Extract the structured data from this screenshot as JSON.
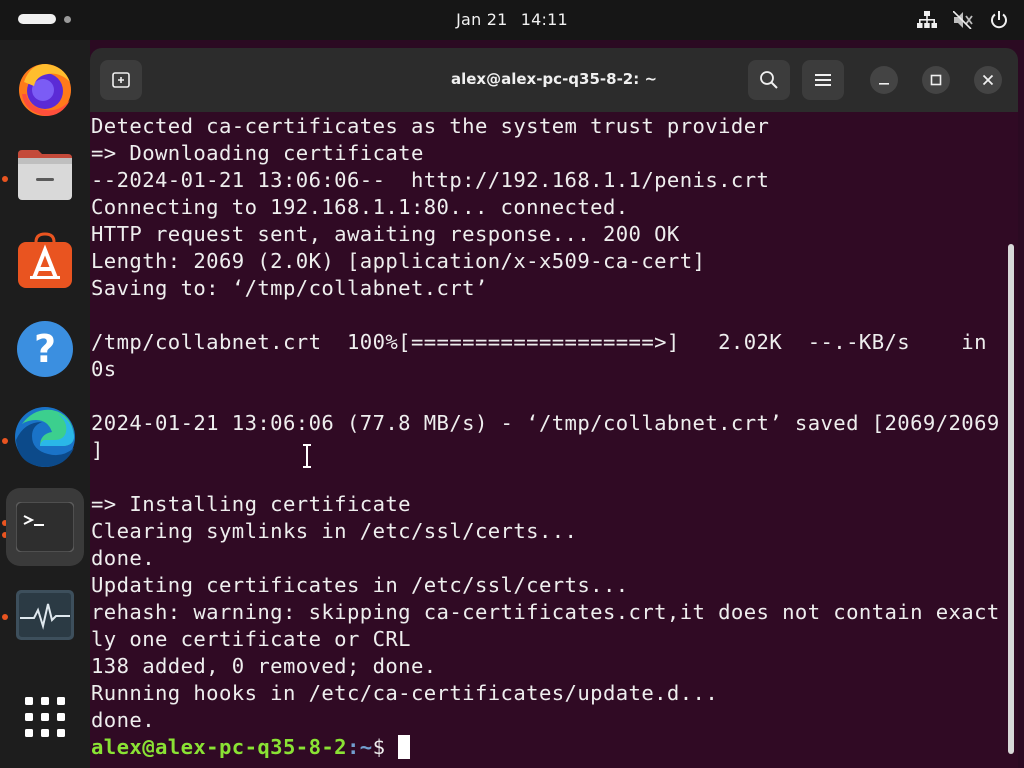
{
  "topbar": {
    "date": "Jan 21",
    "time": "14:11",
    "tray_icons": [
      "network-icon",
      "volume-muted-icon",
      "power-icon"
    ]
  },
  "dock": {
    "items": [
      {
        "name": "firefox",
        "icon": "firefox-icon",
        "running": false
      },
      {
        "name": "files",
        "icon": "files-icon",
        "running": true
      },
      {
        "name": "app-center",
        "icon": "app-center-icon",
        "running": false
      },
      {
        "name": "help",
        "icon": "help-icon",
        "running": false
      },
      {
        "name": "edge",
        "icon": "edge-icon",
        "running": true
      },
      {
        "name": "terminal",
        "icon": "terminal-icon",
        "running": true,
        "active": true
      },
      {
        "name": "system-monitor",
        "icon": "system-monitor-icon",
        "running": true
      },
      {
        "name": "show-apps",
        "icon": "app-grid-icon",
        "running": false
      }
    ]
  },
  "window": {
    "title": "alex@alex-pc-q35-8-2: ~",
    "buttons": [
      "new-tab-icon",
      "search-icon",
      "menu-icon",
      "minimize-icon",
      "maximize-icon",
      "close-icon"
    ]
  },
  "terminal": {
    "lines": [
      "Detected ca-certificates as the system trust provider",
      "=> Downloading certificate",
      "--2024-01-21 13:06:06--  http://192.168.1.1/penis.crt",
      "Connecting to 192.168.1.1:80... connected.",
      "HTTP request sent, awaiting response... 200 OK",
      "Length: 2069 (2.0K) [application/x-x509-ca-cert]",
      "Saving to: ‘/tmp/collabnet.crt’",
      "",
      "/tmp/collabnet.crt  100%[===================>]   2.02K  --.-KB/s    in",
      "0s",
      "",
      "2024-01-21 13:06:06 (77.8 MB/s) - ‘/tmp/collabnet.crt’ saved [2069/2069",
      "]",
      "",
      "=> Installing certificate",
      "Clearing symlinks in /etc/ssl/certs...",
      "done.",
      "Updating certificates in /etc/ssl/certs...",
      "rehash: warning: skipping ca-certificates.crt,it does not contain exact",
      "ly one certificate or CRL",
      "138 added, 0 removed; done.",
      "Running hooks in /etc/ca-certificates/update.d...",
      "done."
    ],
    "prompt_user": "alex@alex-pc-q35-8-2",
    "prompt_path": ":~",
    "prompt_symbol": "$ "
  },
  "colors": {
    "terminal_bg": "#300a24",
    "terminal_fg": "#eeeeee",
    "prompt_user": "#8ae234",
    "prompt_path": "#729fcf",
    "accent": "#e95420"
  }
}
